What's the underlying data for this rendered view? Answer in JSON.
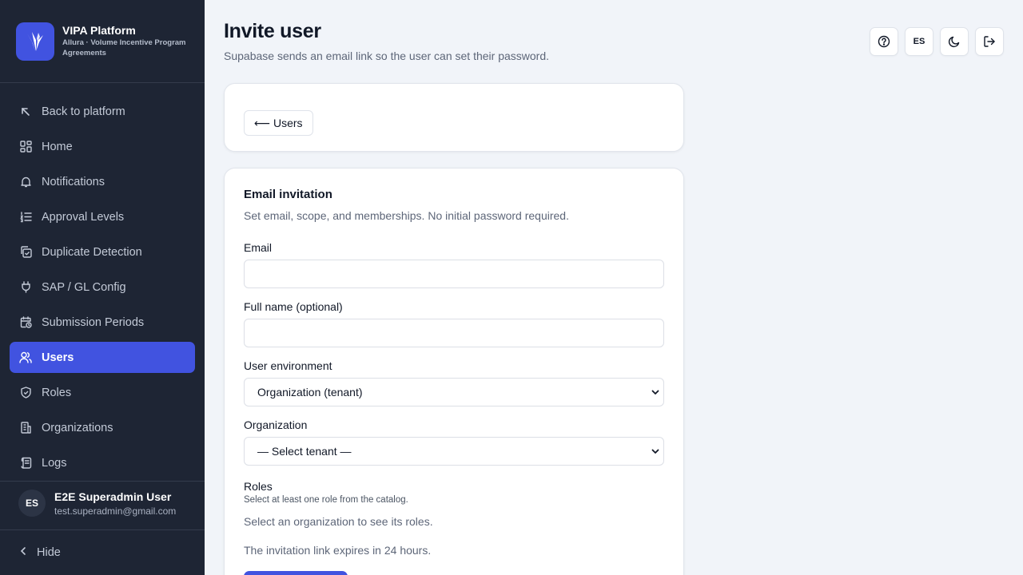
{
  "brand": {
    "title": "VIPA Platform",
    "subtitle": "Allura · Volume Incentive Program Agreements",
    "color": "#4153e0"
  },
  "sidebar": {
    "items": [
      {
        "label": "Back to platform",
        "icon": "arrow-up-left-icon"
      },
      {
        "label": "Home",
        "icon": "dashboard-icon"
      },
      {
        "label": "Notifications",
        "icon": "bell-icon"
      },
      {
        "label": "Approval Levels",
        "icon": "list-ordered-icon"
      },
      {
        "label": "Duplicate Detection",
        "icon": "copy-check-icon"
      },
      {
        "label": "SAP / GL Config",
        "icon": "plug-icon"
      },
      {
        "label": "Submission Periods",
        "icon": "calendar-clock-icon"
      },
      {
        "label": "Users",
        "icon": "users-icon",
        "active": true
      },
      {
        "label": "Roles",
        "icon": "shield-check-icon"
      },
      {
        "label": "Organizations",
        "icon": "building-icon"
      },
      {
        "label": "Logs",
        "icon": "scroll-icon"
      }
    ],
    "user": {
      "initials": "ES",
      "name": "E2E Superadmin User",
      "email": "test.superadmin@gmail.com"
    },
    "hide_label": "Hide"
  },
  "header": {
    "title": "Invite user",
    "subtitle": "Supabase sends an email link so the user can set their password.",
    "lang_label": "ES"
  },
  "back_button": {
    "label": "⟵ Users"
  },
  "form": {
    "title": "Email invitation",
    "subtitle": "Set email, scope, and memberships. No initial password required.",
    "email_label": "Email",
    "email_value": "",
    "fullname_label": "Full name (optional)",
    "fullname_value": "",
    "environment_label": "User environment",
    "environment_value": "Organization (tenant)",
    "organization_label": "Organization",
    "organization_value": "— Select tenant —",
    "roles_label": "Roles",
    "roles_hint": "Select at least one role from the catalog.",
    "roles_empty": "Select an organization to see its roles.",
    "expiry_note": "The invitation link expires in 24 hours."
  }
}
